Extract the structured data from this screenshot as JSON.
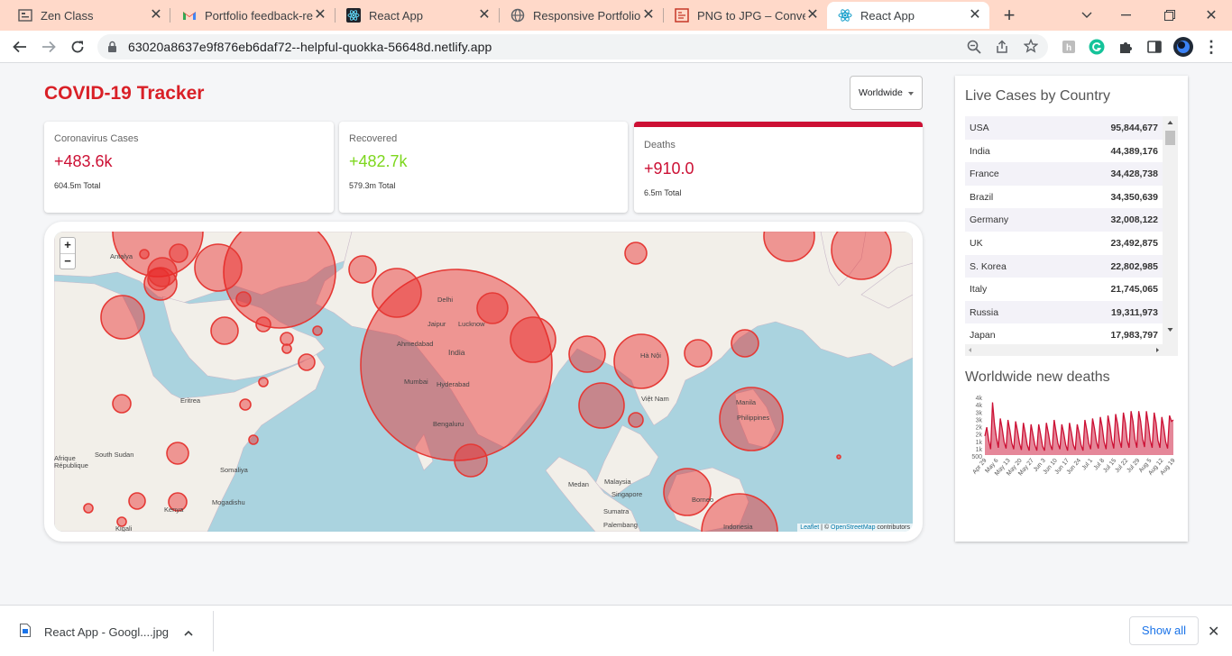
{
  "browser": {
    "tabs": [
      {
        "title": "Zen Class",
        "icon": "zen-class-favicon"
      },
      {
        "title": "Portfolio feedback-req",
        "icon": "gmail-favicon"
      },
      {
        "title": "React App",
        "icon": "react-favicon"
      },
      {
        "title": "Responsive Portfolio W",
        "icon": "globe-favicon"
      },
      {
        "title": "PNG to JPG – Convert",
        "icon": "converter-favicon"
      },
      {
        "title": "React App",
        "icon": "react-favicon",
        "active": true
      }
    ],
    "url": "63020a8637e9f876eb6daf72--helpful-quokka-56648d.netlify.app"
  },
  "app": {
    "title": "COVID-19 Tracker",
    "country_select": "Worldwide"
  },
  "stats": [
    {
      "label": "Coronavirus Cases",
      "value": "+483.6k",
      "total": "604.5m Total",
      "color": "#cc1034"
    },
    {
      "label": "Recovered",
      "value": "+482.7k",
      "total": "579.3m Total",
      "color": "#7dd71d"
    },
    {
      "label": "Deaths",
      "value": "+910.0",
      "total": "6.5m Total",
      "color": "#cc1034"
    }
  ],
  "map": {
    "zoom_in": "+",
    "zoom_out": "−",
    "attribution_leaflet": "Leaflet",
    "attribution_sep": " | © ",
    "attribution_osm": "OpenStreetMap",
    "attribution_tail": " contributors",
    "labels": [
      "Antalya",
      "Delhi",
      "Jaipur",
      "Lucknow",
      "Ahmedabad",
      "India",
      "Mumbai",
      "Hyderabad",
      "Bengaluru",
      "Eritrea",
      "South Sudan",
      "Somaliya",
      "Mogadishu",
      "Kenya",
      "Hà Nội",
      "Việt Nam",
      "Manila",
      "Philippines",
      "Medan",
      "Malaysia",
      "Singapore",
      "Sumatra",
      "Palembang",
      "Borneo",
      "Indonesia",
      "Kigali",
      "République",
      "Afrique"
    ]
  },
  "sidebar": {
    "table_title": "Live Cases by Country",
    "countries": [
      {
        "country": "USA",
        "cases": "95,844,677"
      },
      {
        "country": "India",
        "cases": "44,389,176"
      },
      {
        "country": "France",
        "cases": "34,428,738"
      },
      {
        "country": "Brazil",
        "cases": "34,350,639"
      },
      {
        "country": "Germany",
        "cases": "32,008,122"
      },
      {
        "country": "UK",
        "cases": "23,492,875"
      },
      {
        "country": "S. Korea",
        "cases": "22,802,985"
      },
      {
        "country": "Italy",
        "cases": "21,745,065"
      },
      {
        "country": "Russia",
        "cases": "19,311,973"
      },
      {
        "country": "Japan",
        "cases": "17,983,797"
      }
    ],
    "chart_title": "Worldwide new deaths"
  },
  "chart_data": {
    "type": "area",
    "title": "Worldwide new deaths",
    "y_ticks": [
      "4k",
      "4k",
      "3k",
      "3k",
      "2k",
      "2k",
      "1k",
      "1k",
      "500"
    ],
    "ylim": [
      500,
      4500
    ],
    "x_ticks": [
      "Apr 29",
      "May 6",
      "May 13",
      "May 20",
      "May 27",
      "Jun 3",
      "Jun 10",
      "Jun 17",
      "Jun 24",
      "Jul 1",
      "Jul 8",
      "Jul 15",
      "Jul 22",
      "Jul 29",
      "Aug 5",
      "Aug 12",
      "Aug 19"
    ],
    "values": [
      1800,
      2400,
      1500,
      900,
      4100,
      2600,
      1700,
      1000,
      3000,
      2300,
      1400,
      950,
      2900,
      2200,
      1300,
      900,
      2800,
      2100,
      1300,
      850,
      2700,
      2000,
      1200,
      800,
      2600,
      1900,
      1200,
      800,
      2600,
      1900,
      1100,
      800,
      2700,
      2000,
      1200,
      850,
      2900,
      2100,
      1300,
      900,
      2600,
      2000,
      1200,
      800,
      2700,
      2000,
      1200,
      850,
      2600,
      2000,
      1200,
      800,
      2900,
      2200,
      1300,
      900,
      3000,
      2300,
      1400,
      950,
      3100,
      2400,
      1400,
      900,
      3200,
      2500,
      1500,
      950,
      3300,
      2600,
      1500,
      1000,
      3400,
      2700,
      1500,
      1000,
      3500,
      2800,
      1600,
      1000,
      3500,
      2800,
      1600,
      1050,
      3500,
      2600,
      1500,
      1000,
      3400,
      2700,
      1500,
      1000,
      3100,
      2400,
      1400,
      950,
      3200,
      2800,
      2900
    ],
    "color": "#cc1034"
  },
  "downloads": {
    "file": "React App - Googl....jpg",
    "show_all": "Show all"
  }
}
